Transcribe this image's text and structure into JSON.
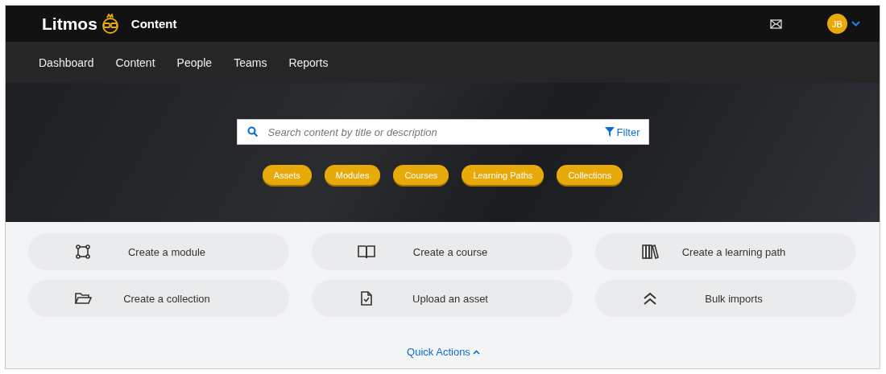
{
  "header": {
    "brand": "Litmos",
    "section": "Content",
    "avatar": "JB"
  },
  "nav": [
    "Dashboard",
    "Content",
    "People",
    "Teams",
    "Reports"
  ],
  "search": {
    "placeholder": "Search content by title or description",
    "filter": "Filter"
  },
  "chips": [
    "Assets",
    "Modules",
    "Courses",
    "Learning Paths",
    "Collections"
  ],
  "actions": [
    {
      "kind": "module",
      "label": "Create a module"
    },
    {
      "kind": "course",
      "label": "Create a course"
    },
    {
      "kind": "path",
      "label": "Create a learning path"
    },
    {
      "kind": "collection",
      "label": "Create a collection"
    },
    {
      "kind": "upload",
      "label": "Upload an asset"
    },
    {
      "kind": "bulk",
      "label": "Bulk imports"
    }
  ],
  "quick_actions": {
    "label": "Quick Actions",
    "expanded": true
  }
}
